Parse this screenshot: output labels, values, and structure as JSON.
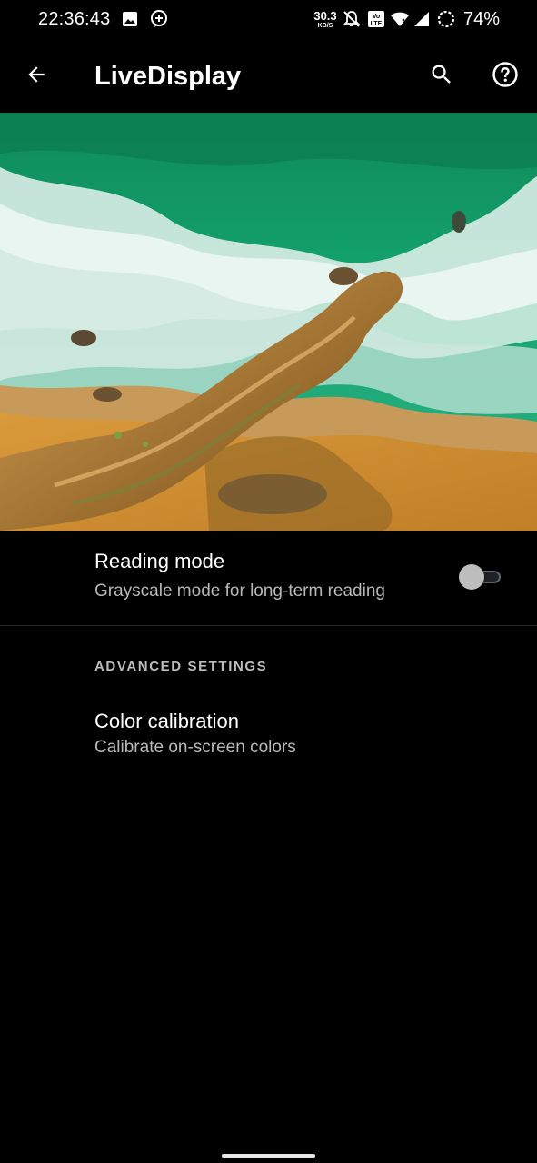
{
  "status_bar": {
    "time": "22:36:43",
    "speed_value": "30.3",
    "speed_unit": "KB/S",
    "battery": "74%",
    "icons": [
      "image-icon",
      "notification-plus-icon",
      "notifications-off-icon",
      "volte-icon",
      "wifi-icon",
      "cell-signal-icon",
      "battery-saver-icon"
    ]
  },
  "app_bar": {
    "title": "LiveDisplay",
    "icons": [
      "back-arrow-icon",
      "search-icon",
      "help-icon"
    ]
  },
  "hero": {
    "description": "aerial beach coastline"
  },
  "reading_mode": {
    "title": "Reading mode",
    "subtitle": "Grayscale mode for long-term reading",
    "enabled": false
  },
  "advanced": {
    "header": "ADVANCED SETTINGS",
    "color_calibration": {
      "title": "Color calibration",
      "subtitle": "Calibrate on-screen colors"
    }
  },
  "colors": {
    "background": "#000000",
    "text_primary": "#ffffff",
    "text_secondary": "#b8b8b8",
    "toggle_off_thumb": "#bdbdbd"
  }
}
